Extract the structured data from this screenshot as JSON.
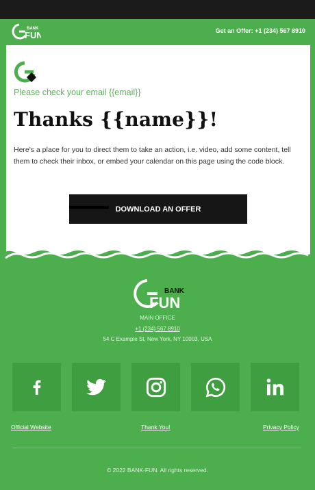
{
  "brand": {
    "word_small": "BANK",
    "word_large": "FUN"
  },
  "header": {
    "offer_text": "Get an Offer: +1 (234) 567 8910"
  },
  "main": {
    "check_email": "Please check your email {{email}}",
    "title": "Thanks {{name}}!",
    "description": "Here's a place for you to direct them to take an action, i.e. video, add some content, tell them to check their inbox, or embed your calendar on this page using the code block.",
    "cta_label": "DOWNLOAD AN OFFER"
  },
  "footer": {
    "office_label": "MAIN OFFICE",
    "phone": "+1 (234) 567 8910",
    "address": "54 C Example St, New York, NY 10003, USA",
    "social": [
      {
        "name": "facebook-icon"
      },
      {
        "name": "twitter-icon"
      },
      {
        "name": "instagram-icon"
      },
      {
        "name": "whatsapp-icon"
      },
      {
        "name": "linkedin-icon"
      }
    ],
    "links": [
      "Official Website",
      "Thank You!",
      "Privacy Policy"
    ],
    "copyright": "© 2022 BANK-FUN. All rights reserved."
  },
  "colors": {
    "brand_green": "#4cae4c",
    "dark": "#161616",
    "white": "#ffffff"
  }
}
